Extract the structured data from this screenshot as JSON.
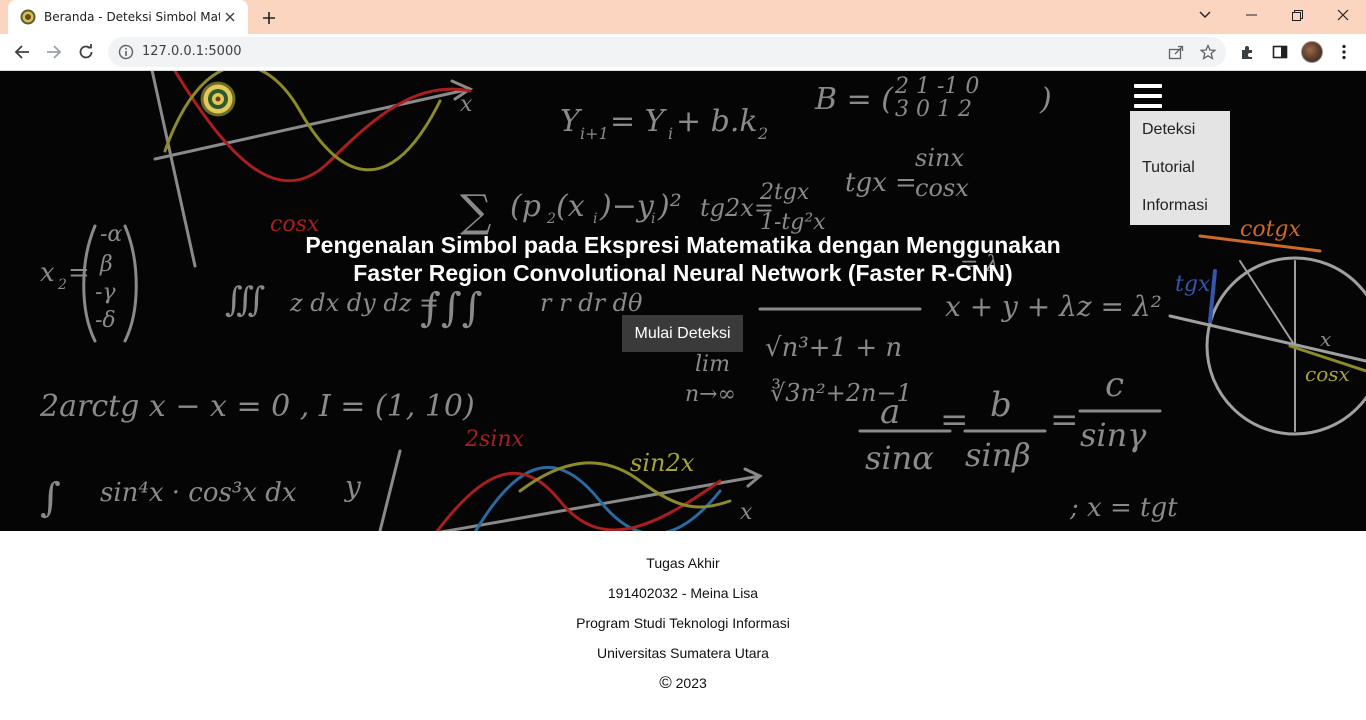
{
  "browser": {
    "tab_title": "Beranda - Deteksi Simbol Matematika",
    "url": "127.0.0.1:5000"
  },
  "nav": {
    "menu_items": [
      "Deteksi",
      "Tutorial",
      "Informasi"
    ]
  },
  "hero": {
    "title_line1": "Pengenalan Simbol pada Ekspresi Matematika dengan Menggunakan",
    "title_line2": "Faster Region Convolutional Neural Network (Faster R-CNN)",
    "button_label": "Mulai Deteksi"
  },
  "footer": {
    "line1": "Tugas Akhir",
    "line2": "191402032 - Meina Lisa",
    "line3": "Program Studi Teknologi Informasi",
    "line4": "Universitas Sumatera Utara",
    "copyright_symbol": "©",
    "year": "2023"
  },
  "background_formulas": [
    "Y(i+1) = Y(i) + b.k2",
    "B = ( 2 1 -1 0 / 3 0 1 2 )",
    "∑ (p2(xi) - yi)²",
    "tg2x = 2tgx / 1-tg²x",
    "tgx = sinx / cosx",
    "cosx",
    "∭ z dx dy dz = ∫∫∫ r r dr dθ",
    "x + y + λz = λ²",
    "lim n→∞ (√(n³+1) + n) / ∛(3n²+2n-1)",
    "2arctgx - x = 0 , I = (1,10)",
    "a / sinα = b / sinβ = c / sinγ",
    "2sinx",
    "sin2x",
    "∫ sin⁴x · cos³x dx",
    "x = tgt",
    "cotgx",
    "tgx",
    "cosx",
    "x2 = (-α, β, -γ, -δ)"
  ],
  "colors": {
    "tab_strip": "#fbd5c0",
    "hero_bg": "#050505",
    "menu_bg": "#e4e4e4",
    "button_bg": "#3a3a3a"
  },
  "icons": [
    "univ-logo-icon",
    "hamburger-menu-icon",
    "back-icon",
    "forward-icon",
    "reload-icon",
    "info-icon",
    "share-icon",
    "bookmark-star-icon",
    "extensions-icon",
    "side-panel-icon",
    "more-vert-icon",
    "tab-search-icon",
    "minimize-icon",
    "restore-icon",
    "close-icon"
  ]
}
